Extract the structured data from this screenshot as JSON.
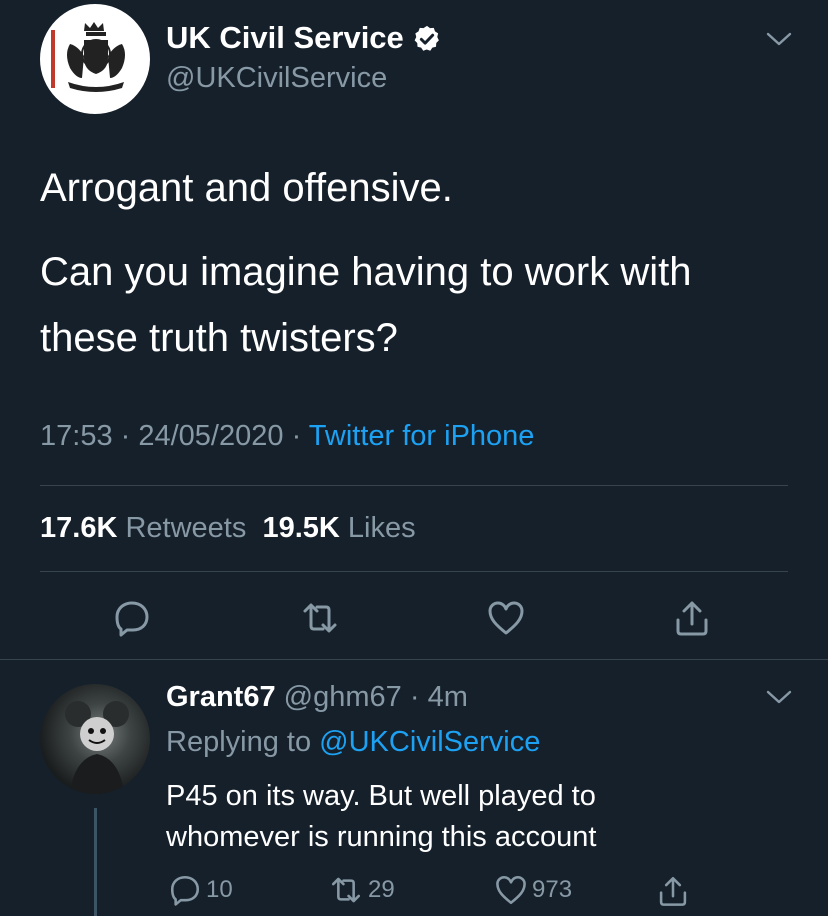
{
  "tweet": {
    "author_name": "UK Civil Service",
    "author_handle": "@UKCivilService",
    "text_line1": "Arrogant and offensive.",
    "text_line2": "Can you imagine having to work with",
    "text_line3": "these truth twisters?",
    "time": "17:53",
    "date": "24/05/2020",
    "source": "Twitter for iPhone",
    "retweet_count": "17.6K",
    "retweet_label": "Retweets",
    "like_count": "19.5K",
    "like_label": "Likes"
  },
  "reply": {
    "author_name": "Grant67",
    "author_handle": "@ghm67",
    "age": "4m",
    "replying_prefix": "Replying to",
    "replying_to": "@UKCivilService",
    "text_line1": "P45 on its way. But well played to",
    "text_line2": "whomever is running this account",
    "reply_count": "10",
    "retweet_count": "29",
    "like_count": "973"
  },
  "colors": {
    "background": "#15202b",
    "secondary_text": "#8899a6",
    "link": "#1da1f2",
    "divider": "#38444d"
  }
}
